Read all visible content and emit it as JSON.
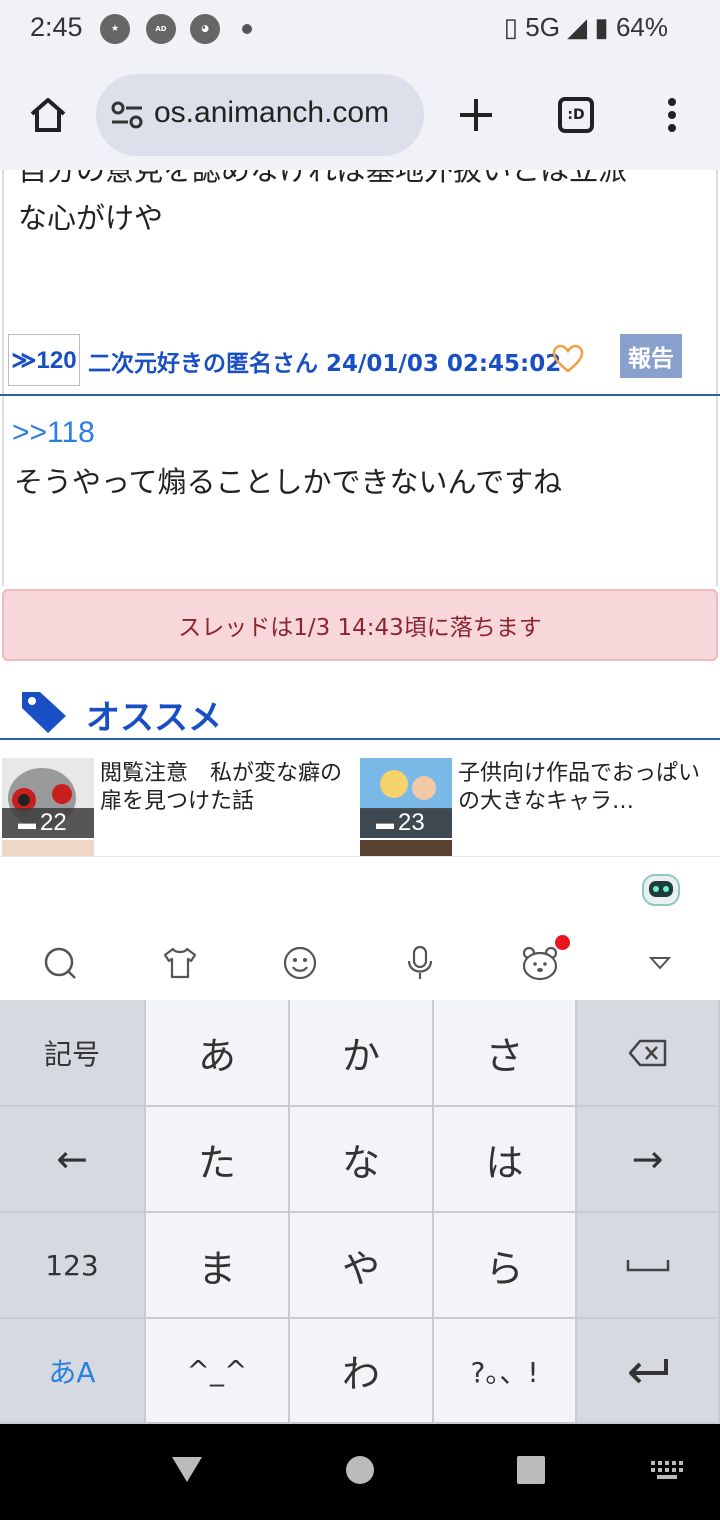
{
  "status_bar": {
    "time": "2:45",
    "icons": [
      "star-notification-icon",
      "ad-blocker-icon",
      "app-icon"
    ],
    "ad_blocker_label": "AD\nBLOCKER",
    "network": "5G",
    "battery": "64%"
  },
  "browser": {
    "url": "os.animanch.com",
    "tab_count_label": ":D"
  },
  "post_prev": {
    "text_partial": "自分の意見を認めなければ基地外扱いとは立派",
    "text_line2": "な心がけや"
  },
  "post_meta": {
    "res_number": "≫120",
    "author_date": "二次元好きの匿名さん 24/01/03 02:45:02",
    "report_label": "報告"
  },
  "post_current": {
    "anchor": ">>118",
    "text": "そうやって煽ることしかできないんですね"
  },
  "alert": {
    "text": "スレッドは1/3 14:43頃に落ちます"
  },
  "recommend": {
    "title": "オススメ",
    "cards": [
      {
        "count": "22",
        "title": "閲覧注意　私が変な癖の扉を見つけた話"
      },
      {
        "count": "23",
        "title": "子供向け作品でおっぱいの大きなキャラ…"
      }
    ]
  },
  "keyboard": {
    "toolbar_icons": [
      "search-icon",
      "shirt-icon",
      "emoji-icon",
      "mic-icon",
      "bear-icon",
      "collapse-icon"
    ],
    "rows": [
      [
        "記号",
        "あ",
        "か",
        "さ",
        "⌫"
      ],
      [
        "←",
        "た",
        "な",
        "は",
        "→"
      ],
      [
        "123",
        "ま",
        "や",
        "ら",
        "␣"
      ],
      [
        "あA",
        "^_^",
        "わ",
        "?。、!",
        "↵"
      ]
    ]
  },
  "colors": {
    "link_blue": "#1a4fc4",
    "alert_bg": "#f8d7da",
    "alert_text": "#8a2430",
    "heart": "#f0a040",
    "report_bg": "#8aa0cc"
  }
}
